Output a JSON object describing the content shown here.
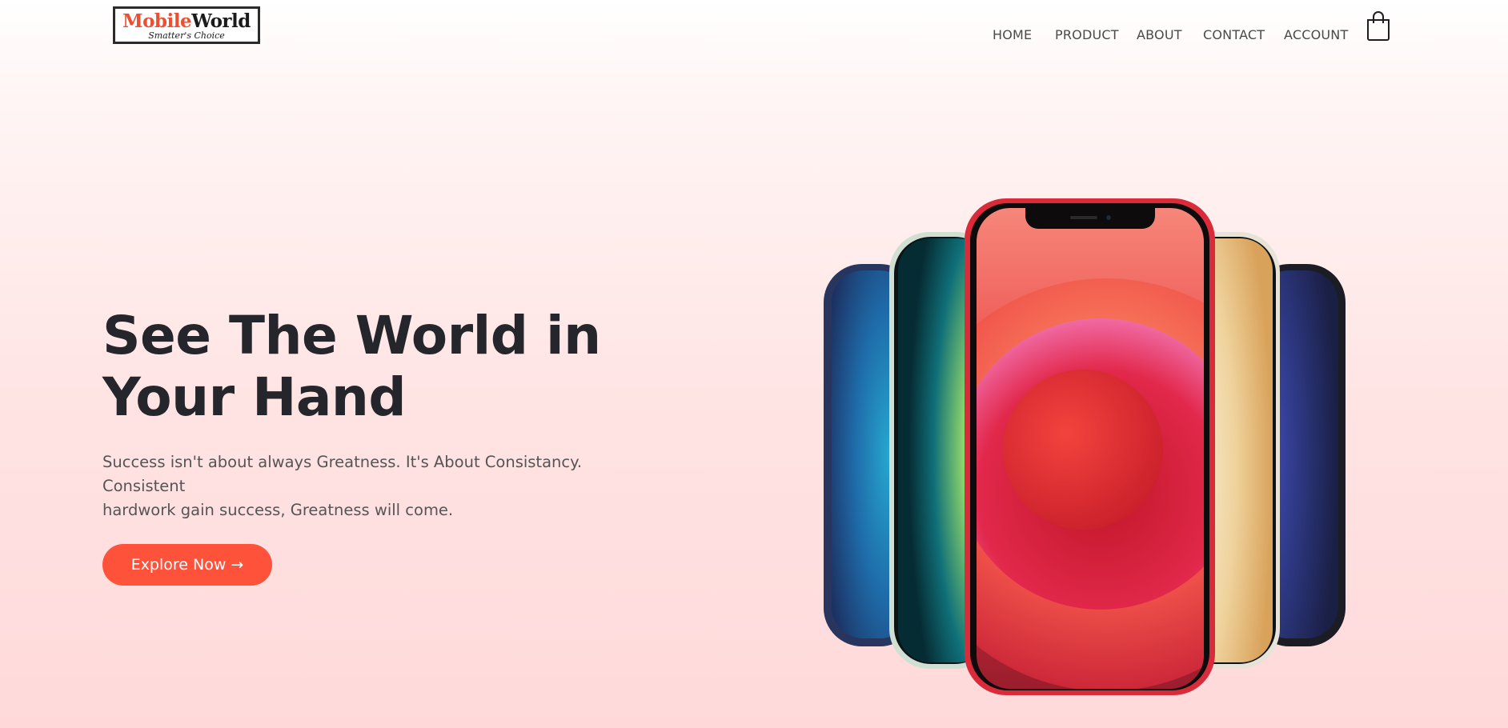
{
  "brand": {
    "name_part1": "Mobile",
    "name_part2": "World",
    "tagline": "Smatter's Choice",
    "accent": "#f04e30"
  },
  "nav": {
    "items": [
      {
        "id": "home",
        "label": "HOME"
      },
      {
        "id": "product",
        "label": "PRODUCT"
      },
      {
        "id": "about",
        "label": "ABOUT"
      },
      {
        "id": "contact",
        "label": "CONTACT"
      },
      {
        "id": "account",
        "label": "ACCOUNT"
      }
    ],
    "cart_icon": "shopping-bag-icon"
  },
  "hero": {
    "title_line1": "See The World in",
    "title_line2": "Your Hand",
    "subtitle_line1": "Success isn't about always Greatness. It's About Consistancy. Consistent",
    "subtitle_line2": "hardwork gain success, Greatness will come.",
    "cta_label": "Explore Now →",
    "cta_color": "#ff523b"
  },
  "image": {
    "icon": "smartphones-image",
    "phone_colors": [
      "#2d3a66",
      "#cfe3d6",
      "#e8333a",
      "#f0ede4",
      "#1c1d26"
    ]
  }
}
